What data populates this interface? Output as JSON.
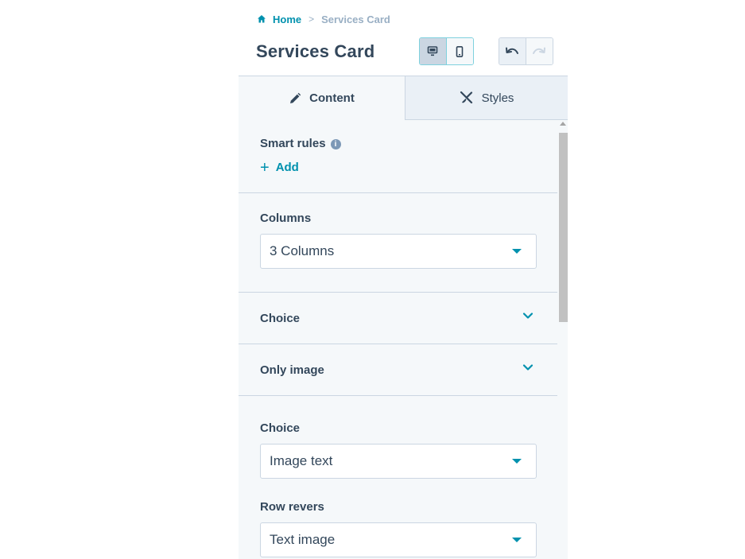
{
  "breadcrumb": {
    "home": "Home",
    "separator": ">",
    "current": "Services Card"
  },
  "header": {
    "title": "Services Card"
  },
  "device_toggle": {
    "desktop_icon": "desktop-icon",
    "mobile_icon": "mobile-icon",
    "active": "desktop"
  },
  "history": {
    "undo_icon": "undo-icon",
    "redo_icon": "redo-icon"
  },
  "tabs": [
    {
      "label": "Content",
      "icon": "pencil-icon",
      "active": true
    },
    {
      "label": "Styles",
      "icon": "brush-icon",
      "active": false
    }
  ],
  "content": {
    "smart_rules": {
      "label": "Smart rules",
      "info_icon": "i",
      "add_label": "Add",
      "add_symbol": "+"
    },
    "columns": {
      "label": "Columns",
      "value": "3 Columns"
    },
    "groups": [
      {
        "label": "Choice"
      },
      {
        "label": "Only image"
      }
    ],
    "choice": {
      "label": "Choice",
      "value": "Image text"
    },
    "row_revers": {
      "label": "Row revers",
      "value": "Text image"
    }
  },
  "colors": {
    "accent": "#0091ae",
    "text": "#33475b",
    "panel_bg": "#f5f8fa",
    "border": "#cbd6e2"
  }
}
